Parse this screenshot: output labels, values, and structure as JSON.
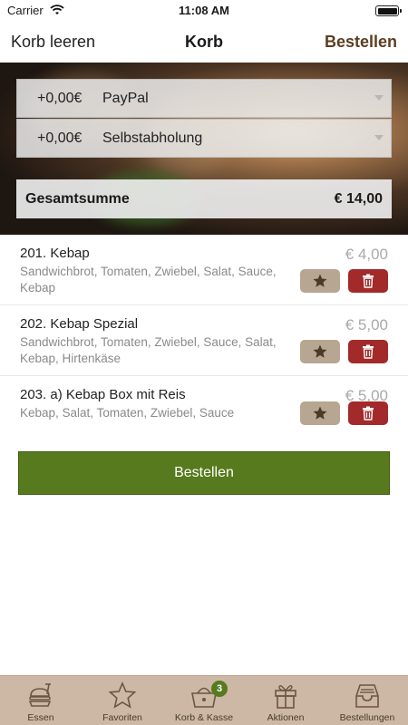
{
  "status": {
    "carrier": "Carrier",
    "time": "11:08 AM"
  },
  "nav": {
    "left": "Korb leeren",
    "title": "Korb",
    "right": "Bestellen"
  },
  "payment": {
    "amount": "+0,00€",
    "method": "PayPal"
  },
  "delivery": {
    "amount": "+0,00€",
    "method": "Selbstabholung"
  },
  "total": {
    "label": "Gesamtsumme",
    "value": "€ 14,00"
  },
  "items": [
    {
      "title": "201. Kebap",
      "desc": "Sandwichbrot, Tomaten, Zwiebel, Salat, Sauce, Kebap",
      "price": "€ 4,00"
    },
    {
      "title": "202. Kebap Spezial",
      "desc": "Sandwichbrot, Tomaten, Zwiebel, Sauce, Salat, Kebap, Hirtenkäse",
      "price": "€ 5,00"
    },
    {
      "title": "203. a) Kebap Box mit Reis",
      "desc": "Kebap, Salat, Tomaten, Zwiebel, Sauce",
      "price": "€ 5,00"
    }
  ],
  "order_button": "Bestellen",
  "tabs": [
    {
      "label": "Essen",
      "icon": "food-icon"
    },
    {
      "label": "Favoriten",
      "icon": "star-icon"
    },
    {
      "label": "Korb & Kasse",
      "icon": "basket-icon",
      "badge": "3"
    },
    {
      "label": "Aktionen",
      "icon": "gift-icon"
    },
    {
      "label": "Bestellungen",
      "icon": "tray-icon"
    }
  ],
  "colors": {
    "accent_green": "#577a1e",
    "brown": "#5b3f22",
    "delete_red": "#a32a2a",
    "tab_bar": "#ccb8a4"
  }
}
